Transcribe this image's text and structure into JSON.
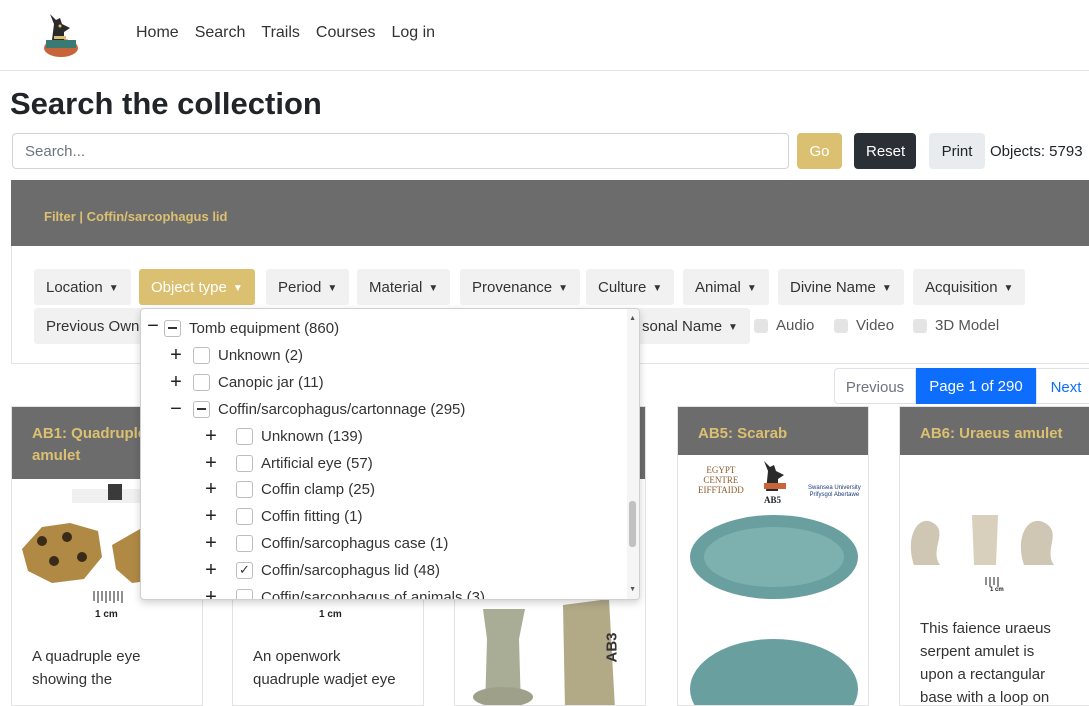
{
  "nav": {
    "links": [
      "Home",
      "Search",
      "Trails",
      "Courses",
      "Log in"
    ]
  },
  "page": {
    "title": "Search the collection"
  },
  "search": {
    "placeholder": "Search...",
    "go_label": "Go",
    "reset_label": "Reset",
    "print_label": "Print",
    "objects_label": "Objects: 5793"
  },
  "filter": {
    "title": "Filter | Coffin/sarcophagus lid",
    "chips_row1": [
      "Location",
      "Object type",
      "Period",
      "Material",
      "Provenance",
      "Culture",
      "Animal",
      "Divine Name",
      "Acquisition"
    ],
    "chips_row2_prefix": "Previous Own",
    "chips_row2_personal": "sonal Name",
    "checkboxes": [
      "Audio",
      "Video",
      "3D Model"
    ]
  },
  "pagination": {
    "previous": "Previous",
    "current": "Page 1 of 290",
    "next": "Next"
  },
  "cards": [
    {
      "title": "AB1: Quadruple eye amulet",
      "title_line1": "AB1: Quadruple",
      "title_line2": "amulet",
      "scale": "1 cm",
      "desc": [
        "A quadruple eye",
        "showing the"
      ]
    },
    {
      "scale": "1 cm",
      "desc": [
        "An openwork",
        "quadruple wadjet eye"
      ]
    },
    {
      "label": "AB3"
    },
    {
      "title": "AB5: Scarab",
      "logo_text": [
        "EGYPT",
        "CENTRE",
        "EIFFTAIDD"
      ],
      "uni_text": [
        "Swansea University",
        "Prifysgol Abertawe"
      ],
      "id_text": "AB5"
    },
    {
      "title": "AB6: Uraeus amulet",
      "scale": "1 cm",
      "desc": [
        "This faience uraeus",
        "serpent amulet is",
        "upon a rectangular",
        "base with a loop on"
      ]
    }
  ],
  "dropdown": {
    "items": [
      {
        "label": "Tomb equipment (860)",
        "toggle": "−",
        "box": "minus"
      },
      {
        "label": "Unknown (2)",
        "toggle": "+",
        "box": "empty"
      },
      {
        "label": "Canopic jar (11)",
        "toggle": "+",
        "box": "empty"
      },
      {
        "label": "Coffin/sarcophagus/cartonnage (295)",
        "toggle": "−",
        "box": "minus"
      },
      {
        "label": "Unknown (139)",
        "toggle": "+",
        "box": "empty"
      },
      {
        "label": "Artificial eye (57)",
        "toggle": "+",
        "box": "empty"
      },
      {
        "label": "Coffin clamp (25)",
        "toggle": "+",
        "box": "empty"
      },
      {
        "label": "Coffin fitting (1)",
        "toggle": "+",
        "box": "empty"
      },
      {
        "label": "Coffin/sarcophagus case (1)",
        "toggle": "+",
        "box": "empty"
      },
      {
        "label": "Coffin/sarcophagus lid (48)",
        "toggle": "+",
        "box": "checked",
        "check_mark": "✓"
      },
      {
        "label": "Coffin/sarcophagus of animals (3)",
        "toggle": "+",
        "box": "empty"
      }
    ],
    "outer_toggle": "−"
  },
  "colors": {
    "gold": "#dcc071",
    "dark": "#2b2f36",
    "header_gray": "#6c6c6c",
    "primary": "#0d6efd"
  }
}
